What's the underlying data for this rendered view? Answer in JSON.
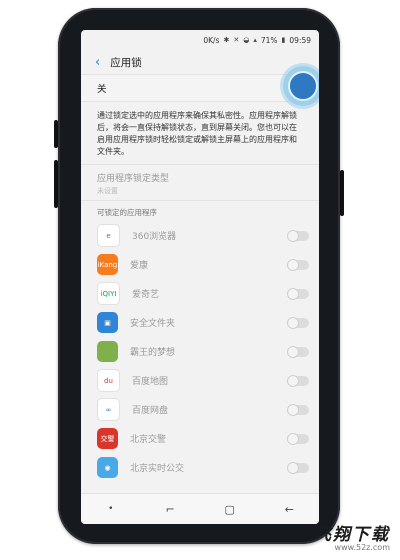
{
  "status": {
    "network_speed": "0K/s",
    "battery": "71%",
    "time": "09:59"
  },
  "appbar": {
    "title": "应用锁"
  },
  "master": {
    "label": "关",
    "state": "off"
  },
  "description": "通过锁定选中的应用程序来确保其私密性。应用程序解锁后，将会一直保持解锁状态，直到屏幕关闭。您也可以在启用应用程序锁时轻松锁定或解锁主屏幕上的应用程序和文件夹。",
  "lock_type": {
    "title": "应用程序锁定类型",
    "value": "未设置"
  },
  "section_header": "可锁定的应用程序",
  "apps": [
    {
      "name": "360浏览器",
      "icon": "360-browser-icon",
      "icon_text": "e",
      "color": "#ffffff",
      "text_color": "#27a43a",
      "enabled": false
    },
    {
      "name": "爱康",
      "icon": "ikang-icon",
      "icon_text": "iKang",
      "color": "#f57c1f",
      "text_color": "#ffffff",
      "enabled": false
    },
    {
      "name": "爱奇艺",
      "icon": "iqiyi-icon",
      "icon_text": "iQIYI",
      "color": "#ffffff",
      "text_color": "#00b43b",
      "enabled": false
    },
    {
      "name": "安全文件夹",
      "icon": "secure-folder-icon",
      "icon_text": "▣",
      "color": "#2f86d6",
      "text_color": "#ffffff",
      "enabled": false
    },
    {
      "name": "霸王的梦想",
      "icon": "game-icon",
      "icon_text": "",
      "color": "#7fb04c",
      "text_color": "#ffffff",
      "enabled": false
    },
    {
      "name": "百度地图",
      "icon": "baidu-map-icon",
      "icon_text": "du",
      "color": "#ffffff",
      "text_color": "#e5392d",
      "enabled": false
    },
    {
      "name": "百度网盘",
      "icon": "baidu-netdisk-icon",
      "icon_text": "∞",
      "color": "#ffffff",
      "text_color": "#2f6fd6",
      "enabled": false
    },
    {
      "name": "北京交警",
      "icon": "beijing-traffic-police-icon",
      "icon_text": "交警",
      "color": "#d9362b",
      "text_color": "#ffffff",
      "enabled": false
    },
    {
      "name": "北京实时公交",
      "icon": "beijing-bus-icon",
      "icon_text": "◉",
      "color": "#49a9e6",
      "text_color": "#ffffff",
      "enabled": false
    }
  ],
  "watermark": {
    "main": "飞翔下载",
    "sub": "www.52z.com"
  },
  "colors": {
    "accent": "#2b7bd6",
    "toggle_highlight": "#9fd0ea"
  }
}
